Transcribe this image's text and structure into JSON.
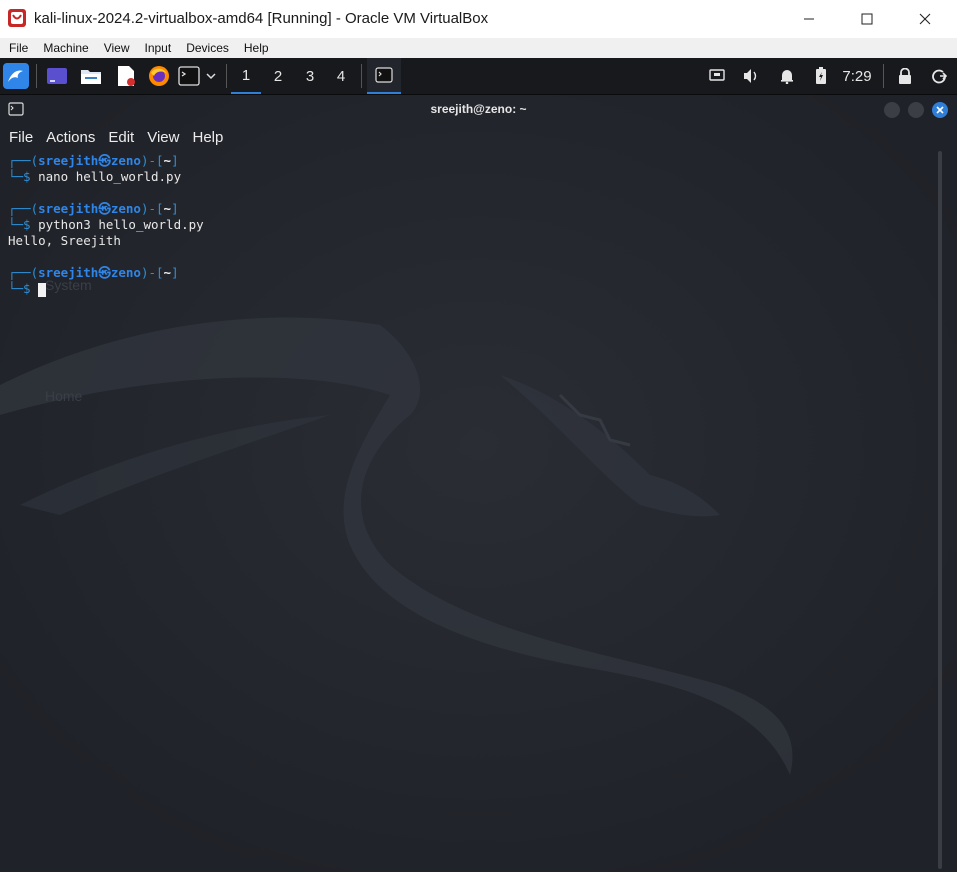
{
  "host_window": {
    "title": "kali-linux-2024.2-virtualbox-amd64 [Running] - Oracle VM VirtualBox",
    "controls": [
      "minimize-icon",
      "maximize-icon",
      "close-icon"
    ]
  },
  "vbox_menu": [
    "File",
    "Machine",
    "View",
    "Input",
    "Devices",
    "Help"
  ],
  "panel": {
    "launchers": [
      "kali-menu-icon",
      "desktop-icon",
      "file-manager-icon",
      "text-editor-icon",
      "firefox-icon",
      "terminal-icon",
      "chevron-down-icon"
    ],
    "workspaces": [
      "1",
      "2",
      "3",
      "4"
    ],
    "active_workspace": "1",
    "clock": "7:29",
    "tray": [
      "network-icon",
      "volume-icon",
      "notification-bell-icon",
      "battery-icon",
      "lock-icon",
      "power-icon"
    ]
  },
  "terminal": {
    "title": "sreejith@zeno: ~",
    "menu": [
      "File",
      "Actions",
      "Edit",
      "View",
      "Help"
    ],
    "prompt": {
      "top_left": "┌──(",
      "user": "sreejith",
      "at": "㉿",
      "host": "zeno",
      "mid": ")-[",
      "dir": "~",
      "end": "]",
      "bottom": "└─$ "
    },
    "blocks": [
      {
        "command": "nano hello_world.py",
        "output": ""
      },
      {
        "command": "python3 hello_world.py",
        "output": "Hello, Sreejith"
      }
    ]
  },
  "desktop_ghost": {
    "system_label": "System",
    "home_label": "Home"
  },
  "colors": {
    "kali_blue": "#2f86e8",
    "terminal_bg": "#23262d",
    "panel_bg": "#17191d"
  }
}
